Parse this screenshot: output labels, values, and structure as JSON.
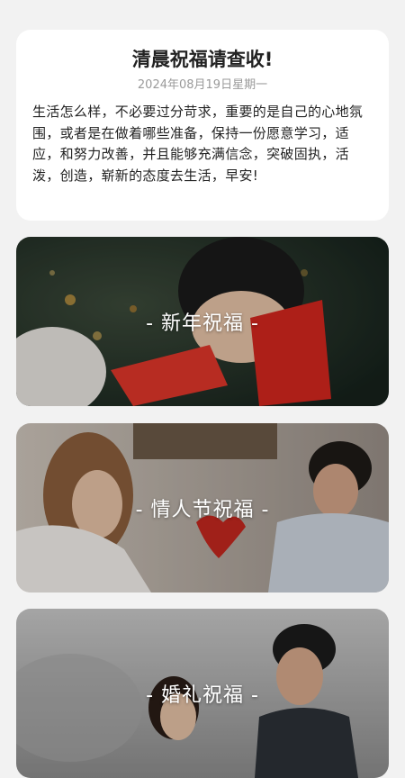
{
  "greeting": {
    "title": "清晨祝福请查收!",
    "date": "2024年08月19日星期一",
    "body": "生活怎么样，不必要过分苛求，重要的是自己的心地氛围，或者是在做着哪些准备，保持一份愿意学习，适应，和努力改善，并且能够充满信念，突破固执，活泼，创造，崭新的态度去生活，早安!"
  },
  "categories": [
    {
      "label": "- 新年祝福 -"
    },
    {
      "label": "- 情人节祝福 -"
    },
    {
      "label": "- 婚礼祝福 -"
    }
  ]
}
